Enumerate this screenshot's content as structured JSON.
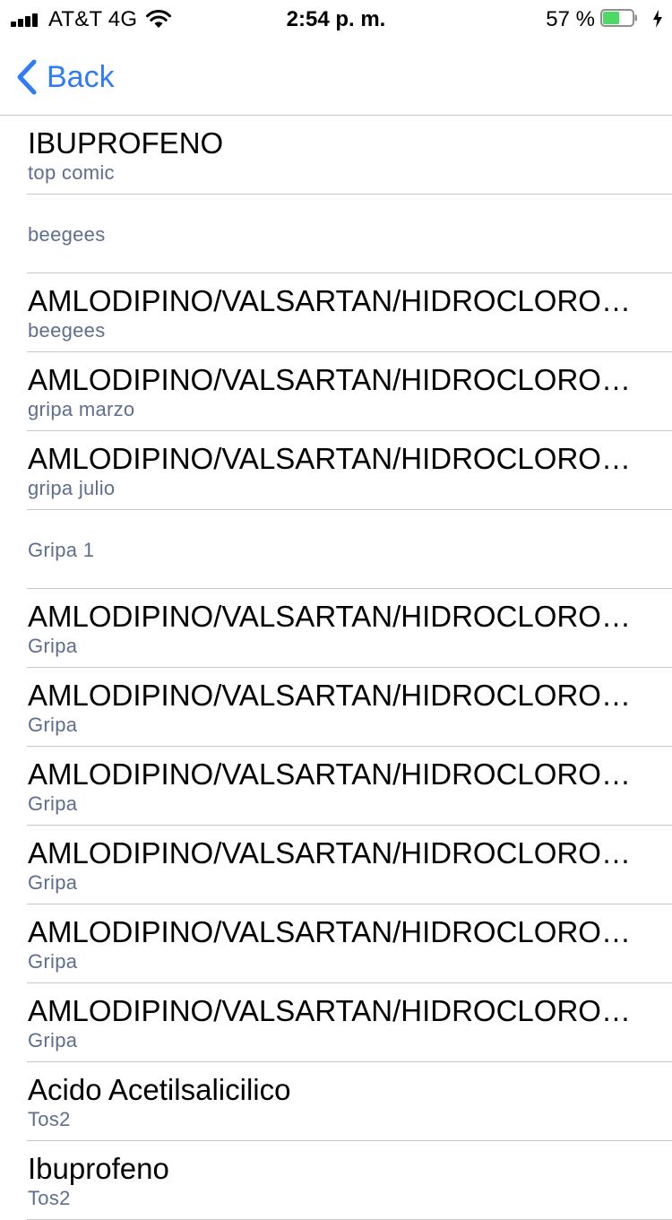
{
  "status_bar": {
    "carrier": "AT&T 4G",
    "time": "2:54 p. m.",
    "battery_percent": "57 %",
    "battery_level": 0.57,
    "battery_color": "#4cd964"
  },
  "nav": {
    "back_label": "Back",
    "accent_color": "#2f7cf6"
  },
  "list": {
    "items": [
      {
        "title": "IBUPROFENO",
        "subtitle": "top comic"
      },
      {
        "title": "",
        "subtitle": "beegees"
      },
      {
        "title": "AMLODIPINO/VALSARTAN/HIDROCLOROTIAZIDA",
        "subtitle": "beegees"
      },
      {
        "title": "AMLODIPINO/VALSARTAN/HIDROCLOROTIAZIDA",
        "subtitle": "gripa marzo"
      },
      {
        "title": "AMLODIPINO/VALSARTAN/HIDROCLOROTIAZIDA",
        "subtitle": "gripa julio"
      },
      {
        "title": "",
        "subtitle": "Gripa 1"
      },
      {
        "title": "AMLODIPINO/VALSARTAN/HIDROCLOROTIAZIDA",
        "subtitle": "Gripa"
      },
      {
        "title": "AMLODIPINO/VALSARTAN/HIDROCLOROTIAZIDA",
        "subtitle": "Gripa"
      },
      {
        "title": "AMLODIPINO/VALSARTAN/HIDROCLOROTIAZIDA",
        "subtitle": "Gripa"
      },
      {
        "title": "AMLODIPINO/VALSARTAN/HIDROCLOROTIAZIDA",
        "subtitle": "Gripa"
      },
      {
        "title": "AMLODIPINO/VALSARTAN/HIDROCLOROTIAZIDA",
        "subtitle": "Gripa"
      },
      {
        "title": "AMLODIPINO/VALSARTAN/HIDROCLOROTIAZIDA",
        "subtitle": "Gripa"
      },
      {
        "title": "Acido Acetilsalicilico",
        "subtitle": "Tos2"
      },
      {
        "title": "Ibuprofeno",
        "subtitle": "Tos2"
      }
    ]
  }
}
